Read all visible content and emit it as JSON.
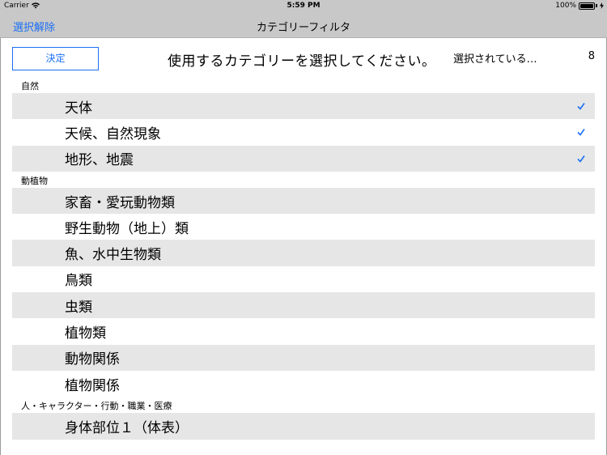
{
  "status_bar": {
    "carrier": "Carrier",
    "time": "5:59 PM",
    "battery": "100%"
  },
  "nav": {
    "deselect_label": "選択解除",
    "title": "カテゴリーフィルタ"
  },
  "toolbar": {
    "done_label": "決定",
    "prompt": "使用するカテゴリーを選択してください。",
    "selected_label": "選択されている…",
    "selected_count": "8"
  },
  "colors": {
    "accent": "#1a6ff5",
    "bar_bg": "#c8c8c8",
    "row_shade": "#e6e6e6"
  },
  "sections": [
    {
      "title": "自然",
      "items": [
        {
          "label": "天体",
          "checked": true,
          "shaded": true
        },
        {
          "label": "天候、自然現象",
          "checked": true,
          "shaded": false
        },
        {
          "label": "地形、地震",
          "checked": true,
          "shaded": true
        }
      ]
    },
    {
      "title": "動植物",
      "items": [
        {
          "label": "家畜・愛玩動物類",
          "checked": false,
          "shaded": true
        },
        {
          "label": "野生動物（地上）類",
          "checked": false,
          "shaded": false
        },
        {
          "label": "魚、水中生物類",
          "checked": false,
          "shaded": true
        },
        {
          "label": "鳥類",
          "checked": false,
          "shaded": false
        },
        {
          "label": "虫類",
          "checked": false,
          "shaded": true
        },
        {
          "label": "植物類",
          "checked": false,
          "shaded": false
        },
        {
          "label": "動物関係",
          "checked": false,
          "shaded": true
        },
        {
          "label": "植物関係",
          "checked": false,
          "shaded": false
        }
      ]
    },
    {
      "title": "人・キャラクター・行動・職業・医療",
      "items": [
        {
          "label": "身体部位１（体表）",
          "checked": false,
          "shaded": true
        }
      ]
    }
  ]
}
